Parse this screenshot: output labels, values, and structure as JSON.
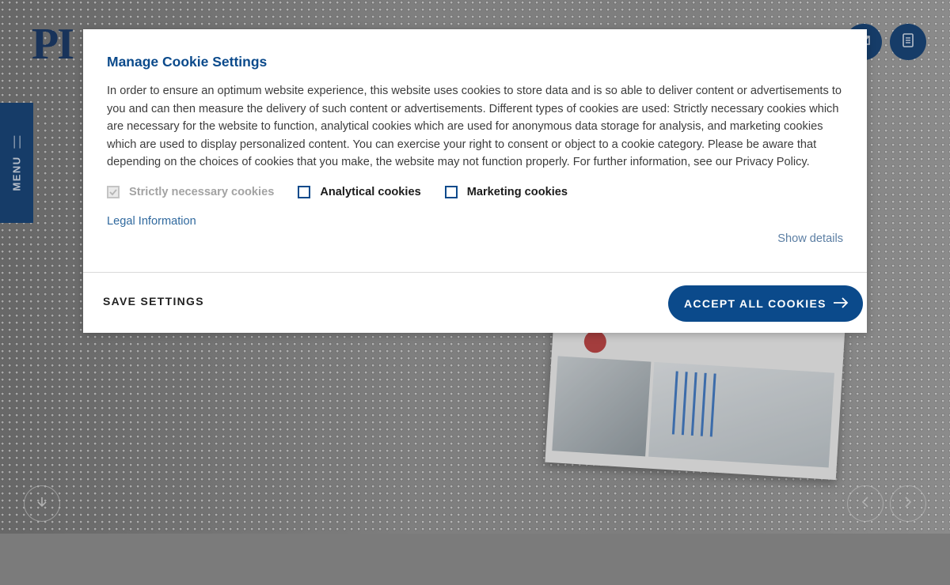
{
  "background": {
    "logo_text": "PI",
    "menu_label": "MENU"
  },
  "cookie_modal": {
    "title": "Manage Cookie Settings",
    "description": "In order to ensure an optimum website experience, this website uses cookies to store data and is so able to deliver content or advertisements to you and can then measure the delivery of such content or advertisements. Different types of cookies are used: Strictly necessary cookies which are necessary for the website to function, analytical cookies which are used for anonymous data storage for analysis, and marketing cookies which are used to display personalized content. You can exercise your right to consent or object to a cookie category. Please be aware that depending on the choices of cookies that you make, the website may not function properly. For further information, see our Privacy Policy.",
    "options": [
      {
        "label": "Strictly necessary cookies",
        "checked": true,
        "disabled": true
      },
      {
        "label": "Analytical cookies",
        "checked": false,
        "disabled": false
      },
      {
        "label": "Marketing cookies",
        "checked": false,
        "disabled": false
      }
    ],
    "legal_link": "Legal Information",
    "show_details": "Show details",
    "save_button": "SAVE SETTINGS",
    "accept_button": "ACCEPT ALL COOKIES"
  },
  "colors": {
    "brand_blue": "#0b4a8b",
    "navy": "#0b3a70"
  },
  "icons": {
    "header_buttons": [
      "contact-icon",
      "clipboard-icon"
    ],
    "accept_arrow": "arrow-right-icon",
    "scroll": "arrow-down-icon",
    "slider": [
      "chevron-left-icon",
      "chevron-right-icon"
    ]
  }
}
